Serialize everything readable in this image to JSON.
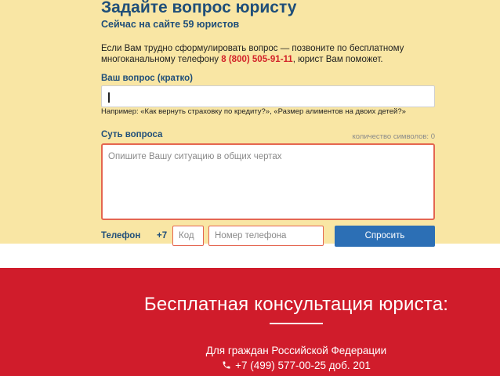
{
  "form": {
    "title": "Задайте вопрос юристу",
    "subtitle": "Сейчас на сайте 59 юристов",
    "info_text_before": "Если Вам трудно сформулировать вопрос — позвоните по бесплатному многоканальному телефону ",
    "info_phone": "8 (800) 505-91-11",
    "info_text_after": ", юрист Вам поможет.",
    "question_label": "Ваш вопрос (кратко)",
    "question_value": "",
    "example_text": "Например: «Как вернуть страховку по кредиту?», «Размер алиментов на двоих детей?»",
    "details_label": "Суть вопроса",
    "char_counter": "количество символов: 0",
    "details_placeholder": "Опишите Вашу ситуацию в общих чертах",
    "phone_label": "Телефон",
    "phone_prefix": "+7",
    "code_placeholder": "Код",
    "number_placeholder": "Номер телефона",
    "submit_label": "Спросить"
  },
  "banner": {
    "title": "Бесплатная консультация юриста:",
    "subtitle": "Для граждан Российской Федерации",
    "phone_icon": "phone-icon",
    "phone": "+7 (499) 577-00-25 доб. 201"
  },
  "colors": {
    "form_background": "#f9e6a4",
    "heading": "#1f4e79",
    "accent_red": "#d2232a",
    "button": "#2c6fb5",
    "banner": "#d01c2b",
    "input_error_border": "#e46650"
  }
}
